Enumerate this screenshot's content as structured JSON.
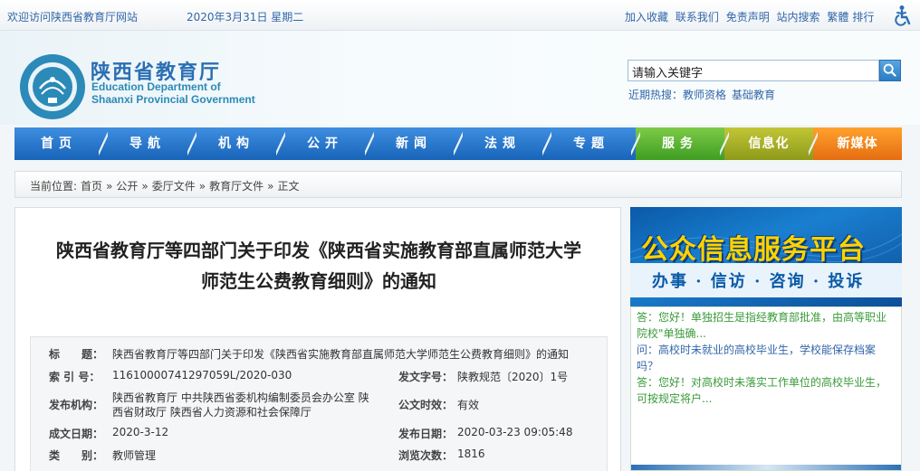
{
  "topbar": {
    "welcome": "欢迎访问陕西省教育厅网站",
    "date": "2020年3月31日 星期二",
    "links": [
      "加入收藏",
      "联系我们",
      "免责声明",
      "站内搜索",
      "繁體",
      "排行"
    ]
  },
  "header": {
    "logo_cn": "陕西省教育厅",
    "logo_en_lines": [
      "Education Department of",
      "Shaanxi Provincial Government"
    ],
    "search_placeholder": "请输入关键字",
    "hot_label": "近期热搜：",
    "hot_items": [
      "教师资格",
      "基础教育"
    ]
  },
  "nav": [
    {
      "label": "首页",
      "color": "blue"
    },
    {
      "label": "导航",
      "color": "blue"
    },
    {
      "label": "机构",
      "color": "blue"
    },
    {
      "label": "公开",
      "color": "blue"
    },
    {
      "label": "新闻",
      "color": "blue"
    },
    {
      "label": "法规",
      "color": "blue"
    },
    {
      "label": "专题",
      "color": "blue"
    },
    {
      "label": "服务",
      "color": "green"
    },
    {
      "label": "信息化",
      "color": "olive"
    },
    {
      "label": "新媒体",
      "color": "orange"
    }
  ],
  "breadcrumb": {
    "prefix": "当前位置:",
    "items": [
      "首页",
      "公开",
      "委厅文件",
      "教育厅文件",
      "正文"
    ],
    "separator": "»"
  },
  "article": {
    "title_line1": "陕西省教育厅等四部门关于印发《陕西省实施教育部直属师范大学",
    "title_line2": "师范生公费教育细则》的通知",
    "meta": {
      "title_key": "标　　题：",
      "title_val": "陕西省教育厅等四部门关于印发《陕西省实施教育部直属师范大学师范生公费教育细则》的通知",
      "index_key": "索 引 号：",
      "index_val": "11610000741297059L/2020-030",
      "doc_no_key": "发文字号：",
      "doc_no_val": "陕教规范〔2020〕1号",
      "issuer_key": "发布机构：",
      "issuer_val_line1": "陕西省教育厅 中共陕西省委机构编制委员会办公室 陕",
      "issuer_val_line2": "西省财政厅 陕西省人力资源和社会保障厅",
      "validity_key": "公文时效：",
      "validity_val": "有效",
      "made_key": "成文日期：",
      "made_val": "2020-3-12",
      "pub_key": "发布日期：",
      "pub_val": "2020-03-23 09:05:48",
      "cat_key": "类　　别：",
      "cat_val": "教师管理",
      "views_key": "浏览次数：",
      "views_val": "1816"
    }
  },
  "sidebar": {
    "promo_title": "公众信息服务平台",
    "promo_sub": "办事 · 信访 · 咨询 · 投诉",
    "qa": [
      {
        "type": "a",
        "line1": "答：您好！单独招生是指经教育部批准，由高等职业",
        "line2": "院校\"单独确..."
      },
      {
        "type": "q",
        "line1": "问：高校时未就业的高校毕业生，学校能保存档案",
        "line2": "吗？"
      },
      {
        "type": "a",
        "line1": "答：您好！对高校时未落实工作单位的高校毕业生，",
        "line2": "可按规定将户..."
      }
    ]
  },
  "colors": {
    "brand_blue": "#2b6fb4",
    "nav_green": "#3f9d22",
    "nav_olive": "#8e9a1a",
    "nav_orange": "#e56d10",
    "promo_yellow": "#ffd200"
  }
}
